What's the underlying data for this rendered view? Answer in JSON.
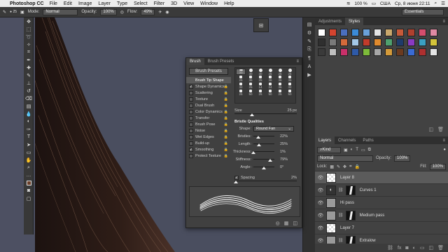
{
  "menubar": {
    "app_name": "Photoshop CC",
    "items": [
      "File",
      "Edit",
      "Image",
      "Layer",
      "Type",
      "Select",
      "Filter",
      "3D",
      "View",
      "Window",
      "Help"
    ],
    "battery": "100 %",
    "locale": "США",
    "datetime": "Ср, 8 июня  22:11"
  },
  "options": {
    "mode_label": "Mode:",
    "mode_value": "Normal",
    "opacity_label": "Opacity:",
    "opacity_value": "100%",
    "flow_label": "Flow:",
    "flow_value": "49%",
    "workspace": "Essentials"
  },
  "styles_panel": {
    "tabs": [
      "Adjustments",
      "Styles"
    ],
    "active_tab": "Styles",
    "swatches": [
      "#ffffff",
      "#d4442f",
      "#4a6fbf",
      "#3b8ad6",
      "#6aa0d9",
      "#e4e4e4",
      "#caa86c",
      "#c75a3a",
      "#b0402e",
      "#d64d6d",
      "#e08aa3",
      "#2f2f2f",
      "#7a7a7a",
      "#d46a3a",
      "#a3c7e6",
      "#c23b2b",
      "#e08a2e",
      "#4fa06e",
      "#1f3b6b",
      "#8a3ac2",
      "#3aa0c2",
      "#d4c43a",
      "#3a3a3a",
      "#bfbfbf",
      "#c9306a",
      "#2e5aa8",
      "#7dbb3a",
      "#a7a7a7",
      "#d49a3a",
      "#6b3a1f",
      "#3a6bd4",
      "#ad2f2f",
      "#e6e6e6"
    ]
  },
  "layers_panel": {
    "tabs": [
      "Layers",
      "Channels",
      "Paths"
    ],
    "active_tab": "Layers",
    "filter_label": "Kind",
    "blend_mode": "Normal",
    "opacity_label": "Opacity:",
    "opacity_value": "100%",
    "lock_label": "Lock:",
    "fill_label": "Fill:",
    "fill_value": "100%",
    "layers": [
      {
        "name": "Layer 8",
        "thumb": "checker",
        "active": true
      },
      {
        "name": "Curves 1",
        "thumb": "adj",
        "mask": true
      },
      {
        "name": "Hi pass",
        "thumb": "gray"
      },
      {
        "name": "Medium pass",
        "thumb": "gray",
        "mask": true
      },
      {
        "name": "Layer 7",
        "thumb": "checker"
      },
      {
        "name": "Extralow",
        "thumb": "gray",
        "mask": true
      }
    ]
  },
  "brush_panel": {
    "tabs": [
      "Brush",
      "Brush Presets"
    ],
    "active_tab": "Brush",
    "presets_button": "Brush Presets",
    "items": [
      {
        "label": "Brush Tip Shape",
        "checkbox": false,
        "heading": true,
        "selected": true
      },
      {
        "label": "Shape Dynamics",
        "checkbox": true,
        "checked": true,
        "lock": true
      },
      {
        "label": "Scattering",
        "checkbox": true,
        "checked": false,
        "lock": true
      },
      {
        "label": "Texture",
        "checkbox": true,
        "checked": false,
        "lock": true
      },
      {
        "label": "Dual Brush",
        "checkbox": true,
        "checked": false,
        "lock": true
      },
      {
        "label": "Color Dynamics",
        "checkbox": true,
        "checked": false,
        "lock": true
      },
      {
        "label": "Transfer",
        "checkbox": true,
        "checked": false,
        "lock": true
      },
      {
        "label": "Brush Pose",
        "checkbox": true,
        "checked": false,
        "lock": true
      },
      {
        "label": "Noise",
        "checkbox": true,
        "checked": false,
        "lock": true
      },
      {
        "label": "Wet Edges",
        "checkbox": true,
        "checked": false,
        "lock": true
      },
      {
        "label": "Build-up",
        "checkbox": true,
        "checked": false,
        "lock": true
      },
      {
        "label": "Smoothing",
        "checkbox": true,
        "checked": true,
        "lock": true
      },
      {
        "label": "Protect Texture",
        "checkbox": true,
        "checked": false,
        "lock": true
      }
    ],
    "tip_sizes": [
      "30",
      "30",
      "30",
      "25",
      "25",
      "25",
      "25",
      "36",
      "25",
      "36",
      "36",
      "36",
      "32",
      "25",
      "14",
      "24",
      "36",
      "32",
      "25",
      "50",
      "25",
      "50",
      "25",
      "50"
    ],
    "size_label": "Size",
    "size_value": "25 px",
    "size_fraction": 0.28,
    "bristle_title": "Bristle Qualities",
    "shape_label": "Shape:",
    "shape_value": "Round Fan",
    "qualities": [
      {
        "label": "Bristles:",
        "value": "22%",
        "level": 0.22
      },
      {
        "label": "Length:",
        "value": "25%",
        "level": 0.25
      },
      {
        "label": "Thickness:",
        "value": "1%",
        "level": 0.01
      },
      {
        "label": "Stiffness:",
        "value": "79%",
        "level": 0.79
      },
      {
        "label": "Angle:",
        "value": "0°",
        "level": 0.5
      }
    ],
    "spacing_label": "Spacing",
    "spacing_value": "2%",
    "spacing_fraction": 0.02
  }
}
